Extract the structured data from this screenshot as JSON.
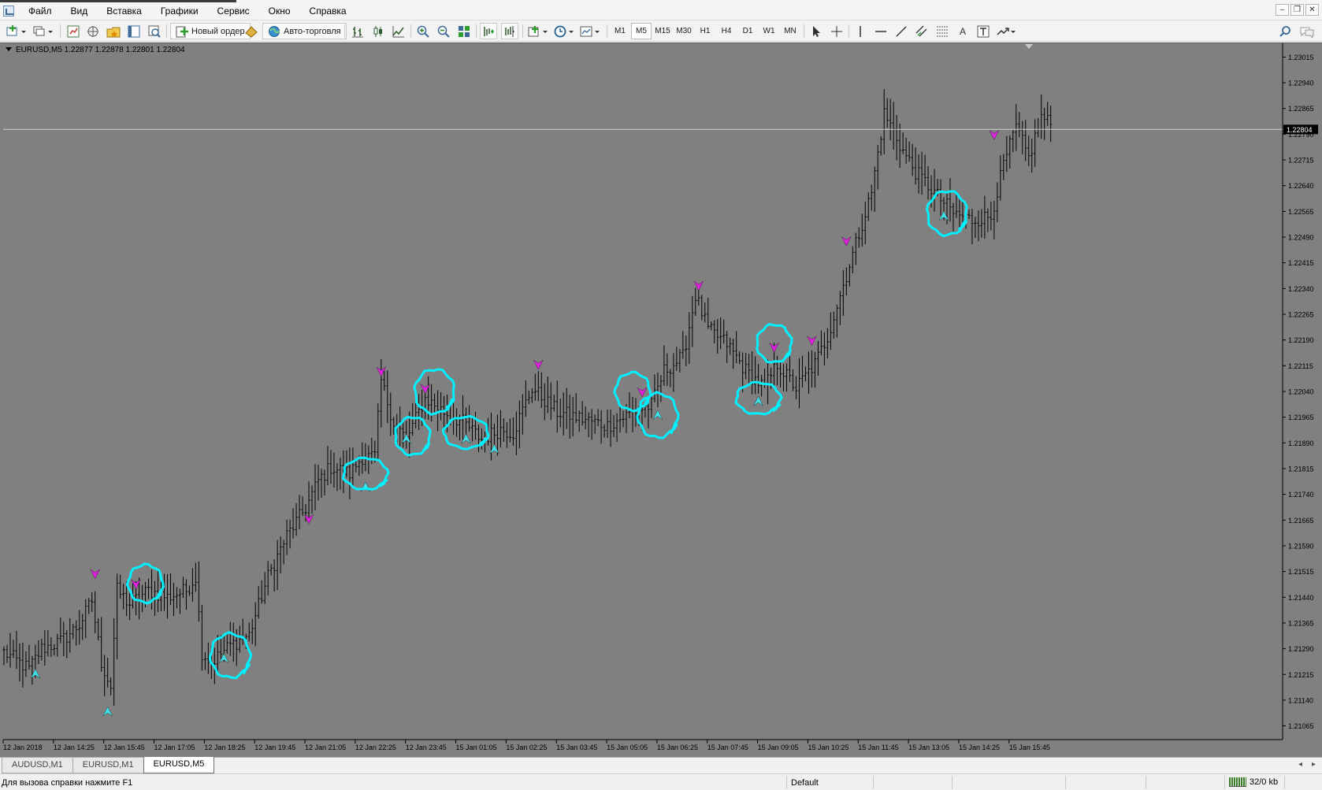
{
  "menu": {
    "items": [
      "Файл",
      "Вид",
      "Вставка",
      "Графики",
      "Сервис",
      "Окно",
      "Справка"
    ]
  },
  "toolbar": {
    "new_order_label": "Новый ордер",
    "autotrading_label": "Авто-торговля",
    "timeframes": [
      "M1",
      "M5",
      "M15",
      "M30",
      "H1",
      "H4",
      "D1",
      "W1",
      "MN"
    ],
    "active_timeframe": "M5",
    "text_tool_label": "A"
  },
  "chart_header": {
    "text": "EURUSD,M5  1.22877 1.22878 1.22801 1.22804"
  },
  "chart_data": {
    "type": "bar",
    "symbol": "EURUSD",
    "timeframe": "M5",
    "ohlc_last": {
      "open": 1.22877,
      "high": 1.22878,
      "low": 1.22801,
      "close": 1.22804
    },
    "current_price": 1.22804,
    "current_price_label": "1.22804",
    "ylim": [
      1.21025,
      1.23055
    ],
    "y_ticks": [
      "1.23015",
      "1.22940",
      "1.22865",
      "1.22790",
      "1.22715",
      "1.22640",
      "1.22565",
      "1.22490",
      "1.22415",
      "1.22340",
      "1.22265",
      "1.22190",
      "1.22115",
      "1.22040",
      "1.21965",
      "1.21890",
      "1.21815",
      "1.21740",
      "1.21665",
      "1.21590",
      "1.21515",
      "1.21440",
      "1.21365",
      "1.21290",
      "1.21215",
      "1.21140",
      "1.21065"
    ],
    "x_ticks": [
      "12 Jan 2018",
      "12 Jan 14:25",
      "12 Jan 15:45",
      "12 Jan 17:05",
      "12 Jan 18:25",
      "12 Jan 19:45",
      "12 Jan 21:05",
      "12 Jan 22:25",
      "12 Jan 23:45",
      "15 Jan 01:05",
      "15 Jan 02:25",
      "15 Jan 03:45",
      "15 Jan 05:05",
      "15 Jan 06:25",
      "15 Jan 07:45",
      "15 Jan 09:05",
      "15 Jan 10:25",
      "15 Jan 11:45",
      "15 Jan 13:05",
      "15 Jan 14:25",
      "15 Jan 15:45"
    ],
    "bars_per_tick": 16,
    "price_path": [
      [
        0,
        1.2128
      ],
      [
        8,
        1.2123
      ],
      [
        12,
        1.2129
      ],
      [
        18,
        1.2131
      ],
      [
        24,
        1.2136
      ],
      [
        28,
        1.2143
      ],
      [
        31,
        1.2125
      ],
      [
        34,
        1.2118
      ],
      [
        36,
        1.2146
      ],
      [
        40,
        1.2142
      ],
      [
        46,
        1.2146
      ],
      [
        52,
        1.2144
      ],
      [
        58,
        1.2146
      ],
      [
        61,
        1.215
      ],
      [
        63,
        1.2128
      ],
      [
        66,
        1.2125
      ],
      [
        72,
        1.213
      ],
      [
        78,
        1.2133
      ],
      [
        84,
        1.215
      ],
      [
        90,
        1.2162
      ],
      [
        96,
        1.217
      ],
      [
        100,
        1.2178
      ],
      [
        104,
        1.2182
      ],
      [
        110,
        1.218
      ],
      [
        114,
        1.2185
      ],
      [
        118,
        1.2185
      ],
      [
        120,
        1.2207
      ],
      [
        124,
        1.2195
      ],
      [
        128,
        1.219
      ],
      [
        134,
        1.2202
      ],
      [
        140,
        1.2198
      ],
      [
        146,
        1.2195
      ],
      [
        152,
        1.219
      ],
      [
        158,
        1.2193
      ],
      [
        162,
        1.2192
      ],
      [
        168,
        1.2205
      ],
      [
        176,
        1.2198
      ],
      [
        184,
        1.2196
      ],
      [
        192,
        1.2194
      ],
      [
        200,
        1.2198
      ],
      [
        206,
        1.22
      ],
      [
        210,
        1.221
      ],
      [
        216,
        1.2214
      ],
      [
        220,
        1.2232
      ],
      [
        224,
        1.2222
      ],
      [
        230,
        1.2218
      ],
      [
        236,
        1.221
      ],
      [
        242,
        1.2205
      ],
      [
        246,
        1.2212
      ],
      [
        252,
        1.2205
      ],
      [
        258,
        1.2212
      ],
      [
        262,
        1.222
      ],
      [
        268,
        1.2238
      ],
      [
        272,
        1.225
      ],
      [
        276,
        1.2262
      ],
      [
        280,
        1.2285
      ],
      [
        283,
        1.228
      ],
      [
        286,
        1.2274
      ],
      [
        290,
        1.2268
      ],
      [
        296,
        1.2262
      ],
      [
        302,
        1.2256
      ],
      [
        308,
        1.2254
      ],
      [
        314,
        1.2255
      ],
      [
        318,
        1.227
      ],
      [
        322,
        1.2281
      ],
      [
        326,
        1.2272
      ],
      [
        330,
        1.2284
      ],
      [
        333,
        1.2282
      ]
    ],
    "signals": [
      {
        "type": "sell",
        "bar": 29,
        "price": 1.2151
      },
      {
        "type": "sell",
        "bar": 42,
        "price": 1.2148
      },
      {
        "type": "buy",
        "bar": 10,
        "price": 1.21215
      },
      {
        "type": "buy",
        "bar": 33,
        "price": 1.21105
      },
      {
        "type": "buy",
        "bar": 70,
        "price": 1.2126
      },
      {
        "type": "sell",
        "bar": 97,
        "price": 1.2167
      },
      {
        "type": "buy",
        "bar": 115,
        "price": 1.2176
      },
      {
        "type": "sell",
        "bar": 120,
        "price": 1.221
      },
      {
        "type": "buy",
        "bar": 128,
        "price": 1.219
      },
      {
        "type": "sell",
        "bar": 134,
        "price": 1.2205
      },
      {
        "type": "buy",
        "bar": 147,
        "price": 1.219
      },
      {
        "type": "buy",
        "bar": 156,
        "price": 1.2187
      },
      {
        "type": "sell",
        "bar": 170,
        "price": 1.2212
      },
      {
        "type": "sell",
        "bar": 203,
        "price": 1.2204
      },
      {
        "type": "buy",
        "bar": 208,
        "price": 1.2197
      },
      {
        "type": "sell",
        "bar": 221,
        "price": 1.2235
      },
      {
        "type": "buy",
        "bar": 240,
        "price": 1.2201
      },
      {
        "type": "sell",
        "bar": 245,
        "price": 1.2217
      },
      {
        "type": "sell",
        "bar": 257,
        "price": 1.2219
      },
      {
        "type": "sell",
        "bar": 268,
        "price": 1.2248
      },
      {
        "type": "buy",
        "bar": 299,
        "price": 1.2255
      },
      {
        "type": "sell",
        "bar": 315,
        "price": 1.2279
      }
    ],
    "annotations": [
      {
        "type": "circle",
        "bar": 45,
        "price": 1.2148
      },
      {
        "type": "circle",
        "bar": 72,
        "price": 1.2127
      },
      {
        "type": "circle",
        "bar": 115,
        "price": 1.218
      },
      {
        "type": "circle",
        "bar": 130,
        "price": 1.2191
      },
      {
        "type": "circle",
        "bar": 137,
        "price": 1.2204
      },
      {
        "type": "circle",
        "bar": 147,
        "price": 1.2192
      },
      {
        "type": "circle",
        "bar": 200,
        "price": 1.2204
      },
      {
        "type": "circle",
        "bar": 208,
        "price": 1.2197
      },
      {
        "type": "circle",
        "bar": 240,
        "price": 1.2202
      },
      {
        "type": "circle",
        "bar": 245,
        "price": 1.2218
      },
      {
        "type": "circle",
        "bar": 300,
        "price": 1.2256
      }
    ],
    "colors": {
      "background": "#808080",
      "bars": "#000000",
      "grid_text": "#000000",
      "buy_signal": "#40e0e8",
      "sell_signal": "#e020e0",
      "annotation": "#00f0ff",
      "price_line": "#d0d0d0"
    },
    "grid": false
  },
  "tabs": [
    "AUDUSD,M1",
    "EURUSD,M1",
    "EURUSD,M5"
  ],
  "active_tab": "EURUSD,M5",
  "status": {
    "help": "Для вызова справки нажмите F1",
    "profile": "Default",
    "traffic": "32/0 kb"
  },
  "icons": [
    "new-chart-icon",
    "profiles-icon",
    "market-watch-icon",
    "navigator-icon",
    "favorites-icon",
    "terminal-icon",
    "tester-icon",
    "new-order-icon",
    "metaeditor-icon",
    "autotrading-icon",
    "bar-chart-icon",
    "candles-icon",
    "line-chart-icon",
    "zoom-in-icon",
    "zoom-out-icon",
    "tile-windows-icon",
    "autoscroll-icon",
    "chart-shift-icon",
    "indicators-icon",
    "periods-icon",
    "templates-icon",
    "cursor-icon",
    "crosshair-icon",
    "vertical-line-icon",
    "horizontal-line-icon",
    "trendline-icon",
    "equidistant-channel-icon",
    "fibonacci-icon",
    "text-label-icon",
    "arrows-icon",
    "search-icon",
    "chat-icon"
  ]
}
